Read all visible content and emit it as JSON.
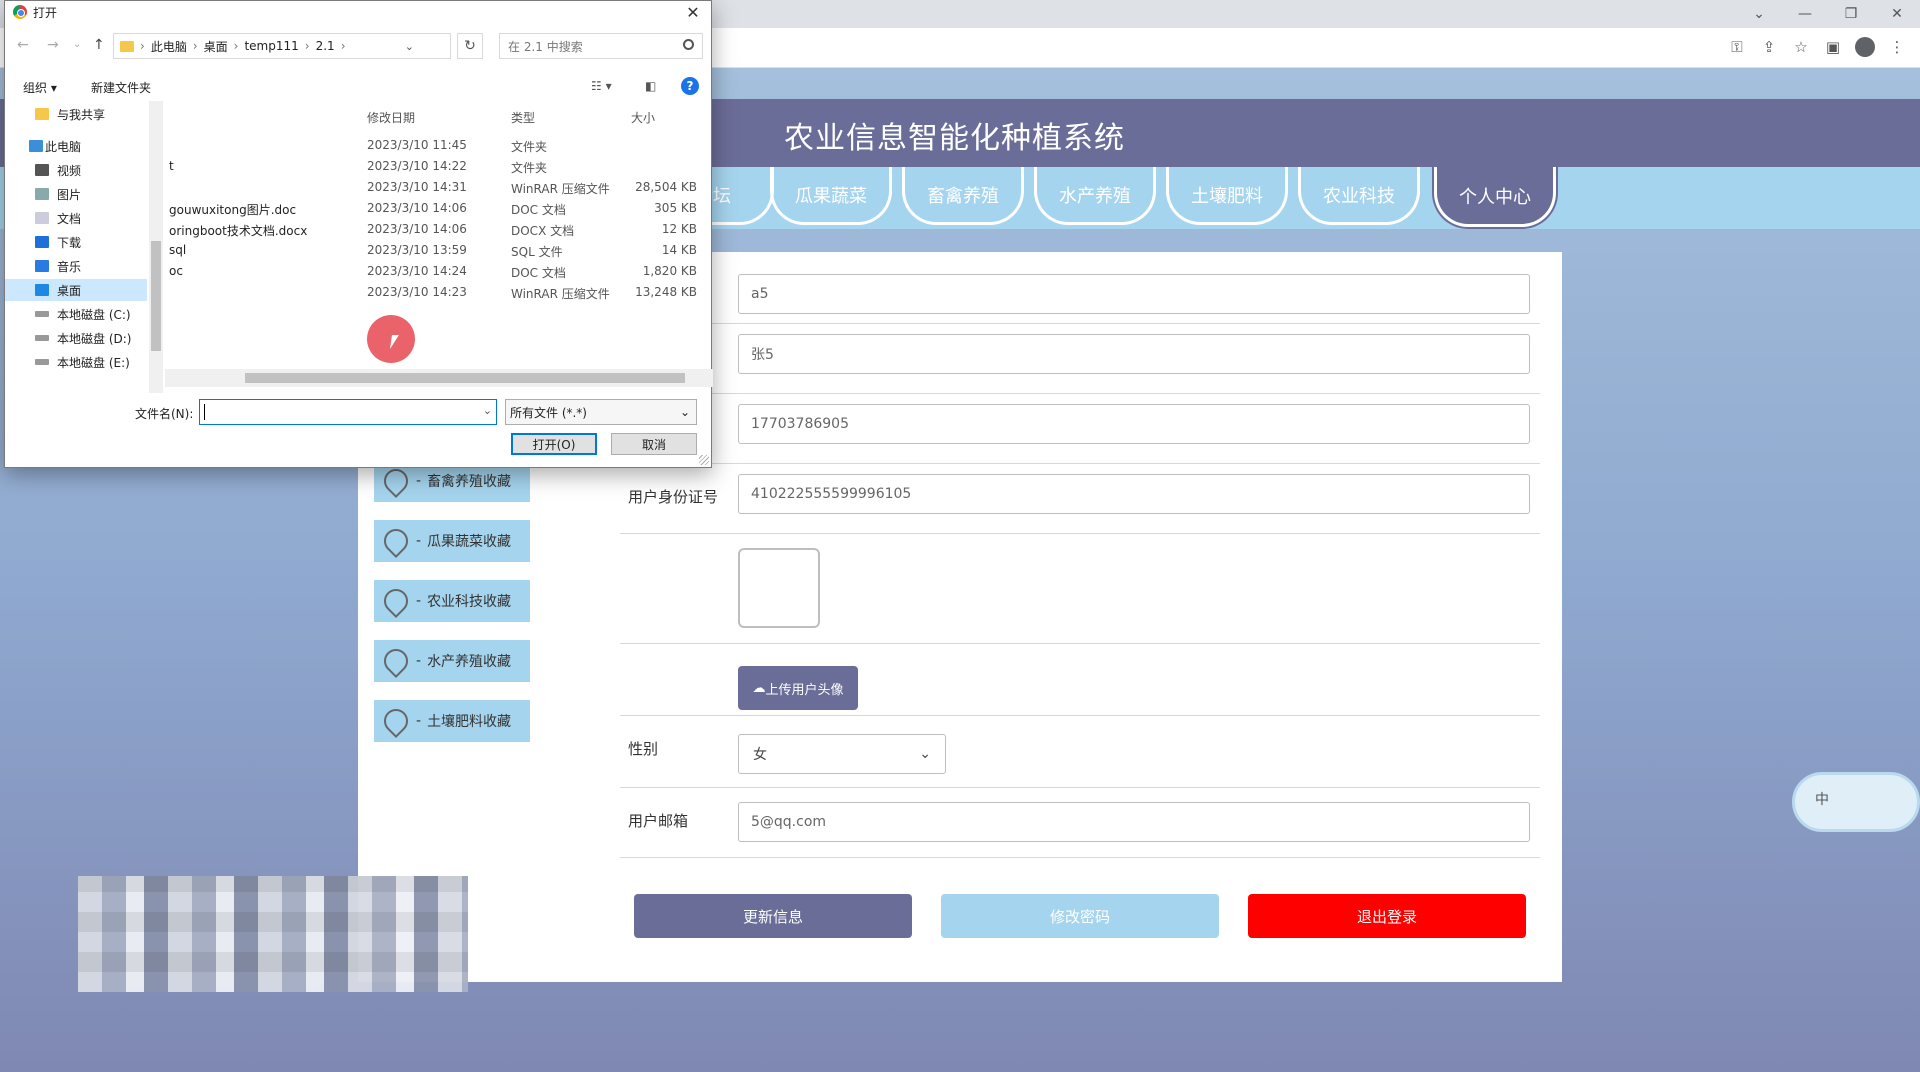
{
  "browser": {
    "window_controls": [
      "⌄",
      "—",
      "❐",
      "✕"
    ],
    "toolbar_icons": [
      "key-icon",
      "share-icon",
      "star-icon",
      "sidepanel-icon",
      "profile-icon",
      "menu-icon"
    ]
  },
  "site": {
    "title": "农业信息智能化种植系统",
    "nav": [
      "论坛",
      "瓜果蔬菜",
      "畜禽养殖",
      "水产养殖",
      "土壤肥料",
      "农业科技",
      "个人中心"
    ],
    "sidebar": [
      "畜禽养殖收藏",
      "瓜果蔬菜收藏",
      "农业科技收藏",
      "水产养殖收藏",
      "土壤肥料收藏"
    ],
    "form": {
      "account_value": "a5",
      "name_value": "张5",
      "phone_value": "17703786905",
      "id_label": "用户身份证号",
      "id_value": "410222555599996105",
      "upload_label": "上传用户头像",
      "gender_label": "性别",
      "gender_value": "女",
      "email_label": "用户邮箱",
      "email_value": "5@qq.com"
    },
    "buttons": {
      "update": "更新信息",
      "change_password": "修改密码",
      "logout": "退出登录"
    },
    "ime_label": "中",
    "colors": {
      "header": "#6b6d99",
      "nav": "#a5d4ee",
      "logout": "#ff0000",
      "password": "#a5d4ee"
    }
  },
  "dialog": {
    "title": "打开",
    "breadcrumb": [
      "此电脑",
      "桌面",
      "temp111",
      "2.1"
    ],
    "search_placeholder": "在 2.1 中搜索",
    "organize": "组织 ▾",
    "new_folder": "新建文件夹",
    "tree": [
      "与我共享",
      "此电脑",
      "视频",
      "图片",
      "文档",
      "下载",
      "音乐",
      "桌面",
      "本地磁盘 (C:)",
      "本地磁盘 (D:)",
      "本地磁盘 (E:)"
    ],
    "columns": {
      "date": "修改日期",
      "type": "类型",
      "size": "大小"
    },
    "files": [
      {
        "name": "",
        "date": "2023/3/10 11:45",
        "type": "文件夹",
        "size": ""
      },
      {
        "name": "t",
        "date": "2023/3/10 14:22",
        "type": "文件夹",
        "size": ""
      },
      {
        "name": "",
        "date": "2023/3/10 14:31",
        "type": "WinRAR 压缩文件",
        "size": "28,504 KB"
      },
      {
        "name": "gouwuxitong图片.doc",
        "date": "2023/3/10 14:06",
        "type": "DOC 文档",
        "size": "305 KB"
      },
      {
        "name": "oringboot技术文档.docx",
        "date": "2023/3/10 14:06",
        "type": "DOCX 文档",
        "size": "12 KB"
      },
      {
        "name": "sql",
        "date": "2023/3/10 13:59",
        "type": "SQL 文件",
        "size": "14 KB"
      },
      {
        "name": "oc",
        "date": "2023/3/10 14:24",
        "type": "DOC 文档",
        "size": "1,820 KB"
      },
      {
        "name": "",
        "date": "2023/3/10 14:23",
        "type": "WinRAR 压缩文件",
        "size": "13,248 KB"
      }
    ],
    "filename_label": "文件名(N):",
    "filename_value": "",
    "filter": "所有文件 (*.*)",
    "open_button": "打开(O)",
    "cancel_button": "取消"
  }
}
